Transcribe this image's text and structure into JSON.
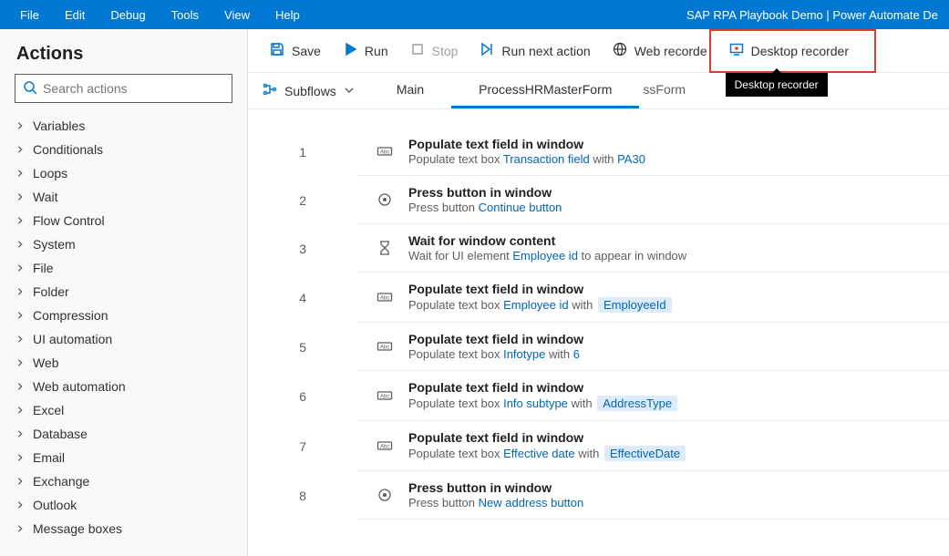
{
  "menubar": {
    "items": [
      "File",
      "Edit",
      "Debug",
      "Tools",
      "View",
      "Help"
    ],
    "title": "SAP RPA Playbook Demo | Power Automate De"
  },
  "toolbar": {
    "save": "Save",
    "run": "Run",
    "stop": "Stop",
    "next": "Run next action",
    "web": "Web recorde",
    "desktop": "Desktop recorder",
    "tooltip": "Desktop recorder"
  },
  "sidebar": {
    "title": "Actions",
    "search_placeholder": "Search actions",
    "categories": [
      "Variables",
      "Conditionals",
      "Loops",
      "Wait",
      "Flow Control",
      "System",
      "File",
      "Folder",
      "Compression",
      "UI automation",
      "Web",
      "Web automation",
      "Excel",
      "Database",
      "Email",
      "Exchange",
      "Outlook",
      "Message boxes"
    ]
  },
  "tabs": {
    "subflows_label": "Subflows",
    "items": [
      "Main",
      "ProcessHRMasterForm"
    ],
    "partial": "ssForm",
    "active_index": 1
  },
  "steps": [
    {
      "num": "1",
      "icon": "textfield",
      "title": "Populate text field in window",
      "desc_plain": "Populate text box ",
      "link1": "Transaction field",
      "plain2": " with ",
      "link2": "PA30"
    },
    {
      "num": "2",
      "icon": "press",
      "title": "Press button in window",
      "desc_plain": "Press button ",
      "link1": "Continue button"
    },
    {
      "num": "3",
      "icon": "wait",
      "title": "Wait for window content",
      "desc_plain": "Wait for UI element ",
      "link1": "Employee id",
      "plain2": " to appear in window"
    },
    {
      "num": "4",
      "icon": "textfield",
      "title": "Populate text field in window",
      "desc_plain": "Populate text box ",
      "link1": "Employee id",
      "plain2": " with ",
      "pill": "EmployeeId"
    },
    {
      "num": "5",
      "icon": "textfield",
      "title": "Populate text field in window",
      "desc_plain": "Populate text box ",
      "link1": "Infotype",
      "plain2": " with ",
      "link2": "6"
    },
    {
      "num": "6",
      "icon": "textfield",
      "title": "Populate text field in window",
      "desc_plain": "Populate text box ",
      "link1": "Info subtype",
      "plain2": " with ",
      "pill": "AddressType"
    },
    {
      "num": "7",
      "icon": "textfield",
      "title": "Populate text field in window",
      "desc_plain": "Populate text box ",
      "link1": "Effective date",
      "plain2": " with ",
      "pill": "EffectiveDate"
    },
    {
      "num": "8",
      "icon": "press",
      "title": "Press button in window",
      "desc_plain": "Press button ",
      "link1": "New address button"
    }
  ]
}
